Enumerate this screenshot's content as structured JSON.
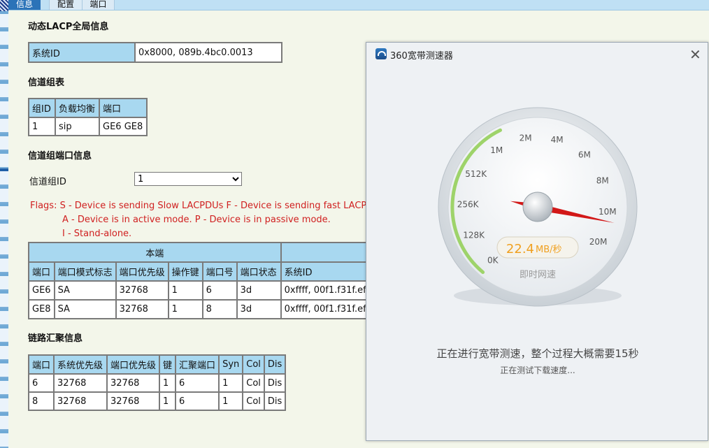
{
  "tabs": [
    {
      "label": "信息"
    },
    {
      "label": "配置"
    },
    {
      "label": "端口"
    }
  ],
  "sections": {
    "global": "动态LACP全局信息",
    "groups": "信道组表",
    "group_ports": "信道组端口信息",
    "aggregation": "链路汇聚信息"
  },
  "global_table": {
    "label": "系统ID",
    "value": "0x8000, 089b.4bc0.0013"
  },
  "group_table": {
    "headers": [
      "组ID",
      "负载均衡",
      "端口"
    ],
    "rows": [
      [
        "1",
        "sip",
        "GE6 GE8"
      ]
    ]
  },
  "group_select": {
    "label": "信道组ID",
    "value": "1"
  },
  "flags": [
    "Flags: S - Device is sending Slow LACPDUs F - Device is sending fast LACPDUs",
    "A - Device is in active mode. P - Device is in passive mode.",
    "I - Stand-alone."
  ],
  "port_table": {
    "group_header": "本端",
    "headers": [
      "端口",
      "端口模式标志",
      "端口优先级",
      "操作键",
      "端口号",
      "端口状态",
      "系统ID"
    ],
    "rows": [
      [
        "GE6",
        "SA",
        "32768",
        "1",
        "6",
        "3d",
        "0xffff, 00f1.f31f.ef"
      ],
      [
        "GE8",
        "SA",
        "32768",
        "1",
        "8",
        "3d",
        "0xffff, 00f1.f31f.ef"
      ]
    ]
  },
  "agg_table": {
    "headers": [
      "端口",
      "系统优先级",
      "端口优先级",
      "键",
      "汇聚端口",
      "Syn",
      "Col",
      "Dis"
    ],
    "rows": [
      [
        "6",
        "32768",
        "32768",
        "1",
        "6",
        "1",
        "Col",
        "Dis"
      ],
      [
        "8",
        "32768",
        "32768",
        "1",
        "6",
        "1",
        "Col",
        "Dis"
      ]
    ]
  },
  "popup": {
    "title": "360宽带测速器",
    "gauge_ticks": [
      "0K",
      "128K",
      "256K",
      "512K",
      "1M",
      "2M",
      "4M",
      "6M",
      "8M",
      "10M",
      "20M"
    ],
    "speed_value": "22.4",
    "speed_unit": "MB/秒",
    "speed_caption": "即时网速",
    "needle_fraction": 0.93,
    "status_main": "正在进行宽带测速，整个过程大概需要15秒",
    "status_sub": "正在测试下载速度..."
  }
}
